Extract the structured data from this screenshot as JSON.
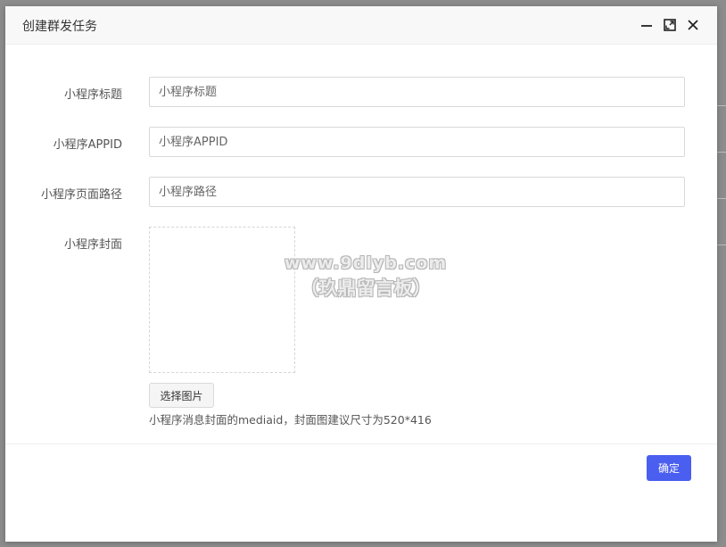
{
  "dialog": {
    "title": "创建群发任务",
    "actions": [
      {
        "icon": "minimize-icon"
      },
      {
        "icon": "maximize-icon"
      },
      {
        "icon": "close-icon"
      }
    ]
  },
  "form": {
    "title": {
      "label": "小程序标题",
      "placeholder": "小程序标题",
      "value": ""
    },
    "appid": {
      "label": "小程序APPID",
      "placeholder": "小程序APPID",
      "value": ""
    },
    "path": {
      "label": "小程序页面路径",
      "placeholder": "小程序路径",
      "value": ""
    },
    "cover": {
      "label": "小程序封面",
      "button_label": "选择图片",
      "hint": "小程序消息封面的mediaid，封面图建议尺寸为520*416"
    }
  },
  "watermark": {
    "line1": "www.9dlyb.com",
    "line2": "（玖鼎留言板）"
  },
  "footer": {
    "confirm_label": "确定"
  },
  "colors": {
    "primary": "#4a5ef0",
    "overlay": "#8c8c8c",
    "header_bg": "#f8f8f8"
  }
}
